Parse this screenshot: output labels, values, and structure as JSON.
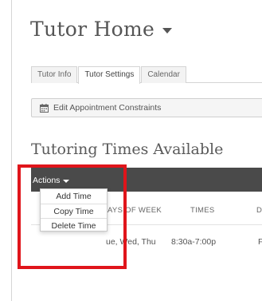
{
  "page": {
    "title": "Tutor Home"
  },
  "tabs": [
    {
      "label": "Tutor Info"
    },
    {
      "label": "Tutor Settings"
    },
    {
      "label": "Calendar"
    }
  ],
  "constraints_button": {
    "label": "Edit Appointment Constraints"
  },
  "section": {
    "title": "Tutoring Times Available"
  },
  "actions": {
    "label": "Actions",
    "menu": [
      {
        "label": "Add Time"
      },
      {
        "label": "Copy Time"
      },
      {
        "label": "Delete Time"
      }
    ]
  },
  "table": {
    "headers": {
      "days_partial": "AYS OF WEEK",
      "times": "TIMES",
      "clipped": "D"
    },
    "rows": [
      {
        "days_partial": "ue, Wed, Thu",
        "times": "8:30a-7:00p",
        "clipped": "F"
      }
    ]
  },
  "colors": {
    "highlight": "#e0151b",
    "header_bar": "#4a4a4a"
  }
}
